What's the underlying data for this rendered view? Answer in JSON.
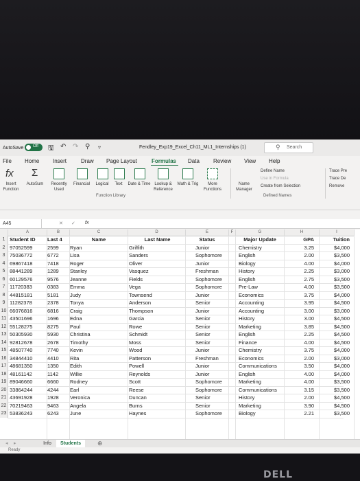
{
  "title_bar": {
    "autosave_label": "AutoSave",
    "toggle_state": "Off",
    "document_title": "Fendley_Exp19_Excel_Ch11_ML1_Internships (1)",
    "search_label": "Search"
  },
  "ribbon_tabs": [
    "File",
    "Home",
    "Insert",
    "Draw",
    "Page Layout",
    "Formulas",
    "Data",
    "Review",
    "View",
    "Help"
  ],
  "active_tab": "Formulas",
  "ribbon": {
    "insert_function": "Insert Function",
    "autosum": "AutoSum",
    "recently_used": "Recently Used",
    "financial": "Financial",
    "logical": "Logical",
    "text": "Text",
    "date_time": "Date & Time",
    "lookup_reference": "Lookup & Reference",
    "math_trig": "Math & Trig",
    "more_functions": "More Functions",
    "function_library_label": "Function Library",
    "name_manager": "Name Manager",
    "define_name": "Define Name",
    "use_in_formula": "Use in Formula",
    "create_from_selection": "Create from Selection",
    "defined_names_label": "Defined Names",
    "trace_precedents": "Trace Pre",
    "trace_dependents": "Trace De",
    "remove_arrows": "Remove"
  },
  "formula_bar": {
    "name_box": "A45",
    "fx": "fx"
  },
  "columns": [
    "A",
    "B",
    "C",
    "D",
    "E",
    "F",
    "G",
    "H",
    "I"
  ],
  "headers": {
    "a": "Student ID",
    "b": "Last 4",
    "c": "Name",
    "d": "Last Name",
    "e": "Status",
    "g": "Major Update",
    "h": "GPA",
    "i": "Tuition"
  },
  "rows": [
    [
      "97052599",
      "2599",
      "Ryan",
      "Griffith",
      "Junior",
      "Chemistry",
      "3.25",
      "$4,000"
    ],
    [
      "75036772",
      "6772",
      "Lisa",
      "Sanders",
      "Sophomore",
      "English",
      "2.00",
      "$3,500"
    ],
    [
      "69867418",
      "7418",
      "Roger",
      "Oliver",
      "Junior",
      "Biology",
      "4.00",
      "$4,000"
    ],
    [
      "88441289",
      "1289",
      "Stanley",
      "Vasquez",
      "Freshman",
      "History",
      "2.25",
      "$3,000"
    ],
    [
      "60129576",
      "9576",
      "Jeanne",
      "Fields",
      "Sophomore",
      "English",
      "2.75",
      "$3,500"
    ],
    [
      "11720383",
      "0383",
      "Emma",
      "Vega",
      "Sophomore",
      "Pre-Law",
      "4.00",
      "$3,500"
    ],
    [
      "44815181",
      "5181",
      "Judy",
      "Townsend",
      "Junior",
      "Economics",
      "3.75",
      "$4,000"
    ],
    [
      "11282378",
      "2378",
      "Tonya",
      "Anderson",
      "Senior",
      "Accounting",
      "3.95",
      "$4,500"
    ],
    [
      "66076816",
      "6816",
      "Craig",
      "Thompson",
      "Junior",
      "Accounting",
      "3.00",
      "$3,000"
    ],
    [
      "43501696",
      "1696",
      "Edna",
      "Garcia",
      "Senior",
      "History",
      "3.00",
      "$4,500"
    ],
    [
      "55128275",
      "8275",
      "Paul",
      "Rowe",
      "Senior",
      "Marketing",
      "3.85",
      "$4,500"
    ],
    [
      "50305930",
      "5930",
      "Christina",
      "Schmidt",
      "Senior",
      "English",
      "2.25",
      "$4,500"
    ],
    [
      "92812678",
      "2678",
      "Timothy",
      "Moss",
      "Senior",
      "Finance",
      "4.00",
      "$4,500"
    ],
    [
      "48507740",
      "7740",
      "Kevin",
      "Wood",
      "Junior",
      "Chemistry",
      "3.75",
      "$4,000"
    ],
    [
      "34844410",
      "4410",
      "Rita",
      "Patterson",
      "Freshman",
      "Economics",
      "2.00",
      "$3,000"
    ],
    [
      "48681350",
      "1350",
      "Edith",
      "Powell",
      "Junior",
      "Communications",
      "3.50",
      "$4,000"
    ],
    [
      "48161142",
      "1142",
      "Willie",
      "Reynolds",
      "Junior",
      "English",
      "4.00",
      "$4,000"
    ],
    [
      "89046660",
      "6660",
      "Rodney",
      "Scott",
      "Sophomore",
      "Marketing",
      "4.00",
      "$3,500"
    ],
    [
      "33864244",
      "4244",
      "Earl",
      "Reese",
      "Sophomore",
      "Communications",
      "3.15",
      "$3,500"
    ],
    [
      "43691928",
      "1928",
      "Veronica",
      "Duncan",
      "Senior",
      "History",
      "2.00",
      "$4,500"
    ],
    [
      "70219463",
      "9463",
      "Angela",
      "Burns",
      "Senior",
      "Marketing",
      "3.90",
      "$4,500"
    ],
    [
      "53836243",
      "6243",
      "June",
      "Haynes",
      "Sophomore",
      "Biology",
      "2.21",
      "$3,500"
    ]
  ],
  "sheet_tabs": [
    "Info",
    "Students"
  ],
  "active_sheet": "Students",
  "status": "Ready",
  "brand": "DELL",
  "colors": {
    "accent": "#217346"
  }
}
